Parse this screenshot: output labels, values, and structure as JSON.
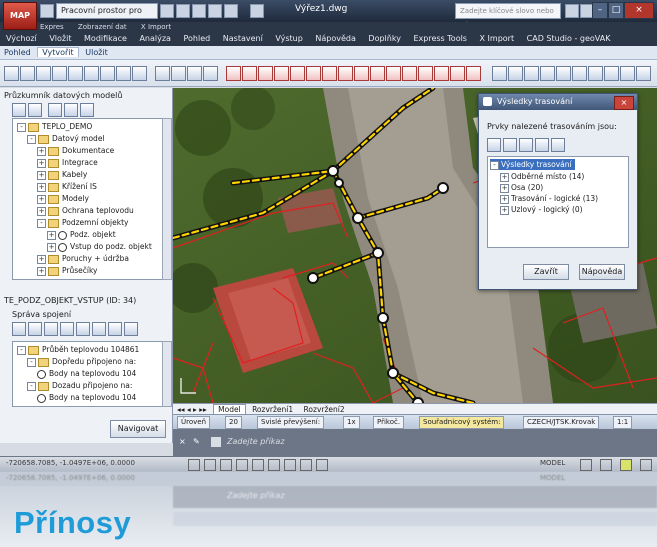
{
  "app": {
    "logo_text": "MAP",
    "workspace": "Pracovní prostor pro účt...",
    "doc_title": "Výřez1.dwg",
    "search_placeholder": "Zadejte klíčové slovo nebo výraz"
  },
  "menu_aux": [
    "Expres",
    "Zobrazení dat",
    "X Import"
  ],
  "menu": [
    "Výchozí",
    "Vložit",
    "Modifikace",
    "Analýza",
    "Pohled",
    "Nastavení",
    "Výstup",
    "Nápověda",
    "Doplňky",
    "Express Tools",
    "X Import",
    "CAD Studio - geoVAK"
  ],
  "ribbon_tabs": [
    {
      "label": "Pohled",
      "active": false
    },
    {
      "label": "Vytvořit",
      "active": true
    },
    {
      "label": "Uložit",
      "active": false
    }
  ],
  "left_panel": {
    "title": "Průzkumník datových modelů",
    "tree": [
      {
        "label": "TEPLO_DEMO",
        "level": 0,
        "expander": "-",
        "icon": "database"
      },
      {
        "label": "Datový model",
        "level": 1,
        "expander": "-",
        "icon": "folder"
      },
      {
        "label": "Dokumentace",
        "level": 2,
        "expander": "+",
        "icon": "folder"
      },
      {
        "label": "Integrace",
        "level": 2,
        "expander": "+",
        "icon": "folder"
      },
      {
        "label": "Kabely",
        "level": 2,
        "expander": "+",
        "icon": "folder"
      },
      {
        "label": "Křížení IS",
        "level": 2,
        "expander": "+",
        "icon": "folder"
      },
      {
        "label": "Modely",
        "level": 2,
        "expander": "+",
        "icon": "folder"
      },
      {
        "label": "Ochrana teplovodu",
        "level": 2,
        "expander": "+",
        "icon": "folder"
      },
      {
        "label": "Podzemní objekty",
        "level": 2,
        "expander": "-",
        "icon": "folder"
      },
      {
        "label": "Podz. objekt",
        "level": 3,
        "expander": "+",
        "icon": "node"
      },
      {
        "label": "Vstup do podz. objekt",
        "level": 3,
        "expander": "+",
        "icon": "node"
      },
      {
        "label": "Poruchy + údržba",
        "level": 2,
        "expander": "+",
        "icon": "folder"
      },
      {
        "label": "Průsečíky",
        "level": 2,
        "expander": "+",
        "icon": "folder"
      }
    ],
    "object_label": "TE_PODZ_OBJEKT_VSTUP (ID: 34)",
    "connections_label": "Správa spojení",
    "tree2": [
      {
        "label": "Průběh teplovodu 104861",
        "level": 0,
        "expander": "-"
      },
      {
        "label": "Dopředu připojeno na:",
        "level": 1,
        "expander": "-"
      },
      {
        "label": "Body na teplovodu 104",
        "level": 2,
        "expander": ""
      },
      {
        "label": "Dozadu připojeno na:",
        "level": 1,
        "expander": "-"
      },
      {
        "label": "Body na teplovodu 104",
        "level": 2,
        "expander": ""
      }
    ],
    "navigate_button": "Navigovat"
  },
  "dialog": {
    "title": "Výsledky trasování",
    "subtitle": "Prvky nalezené trasováním jsou:",
    "results_root": "Výsledky trasování",
    "results": [
      "Odběrné místo (14)",
      "Osa (20)",
      "Trasování - logické (13)",
      "Uzlový - logický (0)"
    ],
    "close_button": "Zavřít",
    "help_button": "Nápověda"
  },
  "layout_tabs": [
    "Model",
    "Rozvržení1",
    "Rozvržení2"
  ],
  "status_items": [
    "Úroveň",
    "20",
    "Svislé převýšení:",
    "1x",
    "Přikoč.",
    "Souřadnicový systém:",
    "CZECH/JTSK.Krovak",
    "1:1"
  ],
  "command": {
    "prompt": "Zadejte příkaz"
  },
  "coordinates": "-720658.7085, -1.0497E+06, 0.0000",
  "model_indicator": "MODEL",
  "footer": {
    "heading": "Přínosy"
  },
  "colors": {
    "accent": "#1f9cd8",
    "pipe": "#ffd400",
    "parcel": "#e02020"
  }
}
